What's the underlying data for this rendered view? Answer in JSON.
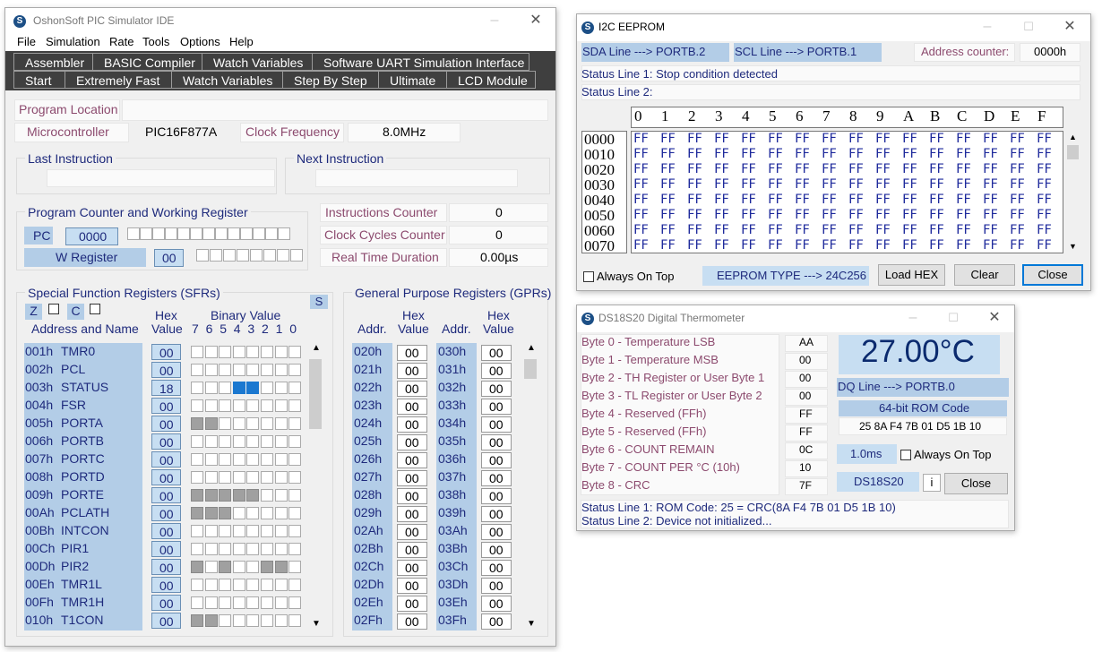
{
  "main": {
    "title": "OshonSoft PIC Simulator IDE",
    "menu": [
      "File",
      "Simulation",
      "Rate",
      "Tools",
      "Options",
      "Help"
    ],
    "toolbar1": [
      "Assembler",
      "BASIC Compiler",
      "Watch Variables",
      "Software UART Simulation Interface"
    ],
    "toolbar2": [
      "Start",
      "Extremely Fast",
      "Watch Variables",
      "Step By Step",
      "Ultimate",
      "LCD Module"
    ],
    "program_location_label": "Program Location",
    "microcontroller_label": "Microcontroller",
    "microcontroller_value": "PIC16F877A",
    "clock_frequency_label": "Clock Frequency",
    "clock_frequency_value": "8.0MHz",
    "last_instruction_label": "Last Instruction",
    "next_instruction_label": "Next Instruction",
    "pcwr_label": "Program Counter and Working Register",
    "pc_label": "PC",
    "pc_value": "0000",
    "w_label": "W Register",
    "w_value": "00",
    "instructions_counter_label": "Instructions Counter",
    "instructions_counter_value": "0",
    "clock_cycles_label": "Clock Cycles Counter",
    "clock_cycles_value": "0",
    "real_time_label": "Real Time Duration",
    "real_time_value": "0.00µs",
    "sfr_label": "Special Function Registers (SFRs)",
    "s_button": "S",
    "z_label": "Z",
    "c_label": "C",
    "addr_name_header": "Address and Name",
    "hex_header1": "Hex",
    "hex_header2": "Value",
    "binary_header": "Binary Value",
    "bit_numbers": [
      "7",
      "6",
      "5",
      "4",
      "3",
      "2",
      "1",
      "0"
    ],
    "sfrs": [
      {
        "addr": "001h",
        "name": "TMR0",
        "value": "00",
        "bits": "--------"
      },
      {
        "addr": "002h",
        "name": "PCL",
        "value": "00",
        "bits": "--------"
      },
      {
        "addr": "003h",
        "name": "STATUS",
        "value": "18",
        "bits": "---11---"
      },
      {
        "addr": "004h",
        "name": "FSR",
        "value": "00",
        "bits": "--------"
      },
      {
        "addr": "005h",
        "name": "PORTA",
        "value": "00",
        "bits": "gg------"
      },
      {
        "addr": "006h",
        "name": "PORTB",
        "value": "00",
        "bits": "--------"
      },
      {
        "addr": "007h",
        "name": "PORTC",
        "value": "00",
        "bits": "--------"
      },
      {
        "addr": "008h",
        "name": "PORTD",
        "value": "00",
        "bits": "--------"
      },
      {
        "addr": "009h",
        "name": "PORTE",
        "value": "00",
        "bits": "ggggg---"
      },
      {
        "addr": "00Ah",
        "name": "PCLATH",
        "value": "00",
        "bits": "ggg-----"
      },
      {
        "addr": "00Bh",
        "name": "INTCON",
        "value": "00",
        "bits": "--------"
      },
      {
        "addr": "00Ch",
        "name": "PIR1",
        "value": "00",
        "bits": "--------"
      },
      {
        "addr": "00Dh",
        "name": "PIR2",
        "value": "00",
        "bits": "g-g--gg-"
      },
      {
        "addr": "00Eh",
        "name": "TMR1L",
        "value": "00",
        "bits": "--------"
      },
      {
        "addr": "00Fh",
        "name": "TMR1H",
        "value": "00",
        "bits": "--------"
      },
      {
        "addr": "010h",
        "name": "T1CON",
        "value": "00",
        "bits": "gg------"
      }
    ],
    "gpr_label": "General Purpose Registers (GPRs)",
    "addr_header": "Addr.",
    "gpr_left": [
      {
        "addr": "020h",
        "value": "00"
      },
      {
        "addr": "021h",
        "value": "00"
      },
      {
        "addr": "022h",
        "value": "00"
      },
      {
        "addr": "023h",
        "value": "00"
      },
      {
        "addr": "024h",
        "value": "00"
      },
      {
        "addr": "025h",
        "value": "00"
      },
      {
        "addr": "026h",
        "value": "00"
      },
      {
        "addr": "027h",
        "value": "00"
      },
      {
        "addr": "028h",
        "value": "00"
      },
      {
        "addr": "029h",
        "value": "00"
      },
      {
        "addr": "02Ah",
        "value": "00"
      },
      {
        "addr": "02Bh",
        "value": "00"
      },
      {
        "addr": "02Ch",
        "value": "00"
      },
      {
        "addr": "02Dh",
        "value": "00"
      },
      {
        "addr": "02Eh",
        "value": "00"
      },
      {
        "addr": "02Fh",
        "value": "00"
      }
    ],
    "gpr_right": [
      {
        "addr": "030h",
        "value": "00"
      },
      {
        "addr": "031h",
        "value": "00"
      },
      {
        "addr": "032h",
        "value": "00"
      },
      {
        "addr": "033h",
        "value": "00"
      },
      {
        "addr": "034h",
        "value": "00"
      },
      {
        "addr": "035h",
        "value": "00"
      },
      {
        "addr": "036h",
        "value": "00"
      },
      {
        "addr": "037h",
        "value": "00"
      },
      {
        "addr": "038h",
        "value": "00"
      },
      {
        "addr": "039h",
        "value": "00"
      },
      {
        "addr": "03Ah",
        "value": "00"
      },
      {
        "addr": "03Bh",
        "value": "00"
      },
      {
        "addr": "03Ch",
        "value": "00"
      },
      {
        "addr": "03Dh",
        "value": "00"
      },
      {
        "addr": "03Eh",
        "value": "00"
      },
      {
        "addr": "03Fh",
        "value": "00"
      }
    ]
  },
  "eeprom": {
    "title": "I2C EEPROM",
    "sda": "SDA Line ---> PORTB.2",
    "scl": "SCL Line ---> PORTB.1",
    "address_counter_label": "Address counter:",
    "address_counter_value": "0000h",
    "status1": "Status Line 1: Stop condition detected",
    "status2": "Status Line 2:",
    "col_headers": [
      "0",
      "1",
      "2",
      "3",
      "4",
      "5",
      "6",
      "7",
      "8",
      "9",
      "A",
      "B",
      "C",
      "D",
      "E",
      "F"
    ],
    "row_addrs": [
      "0000",
      "0010",
      "0020",
      "0030",
      "0040",
      "0050",
      "0060",
      "0070"
    ],
    "cell_value": "FF",
    "always_on_top": "Always On Top",
    "type": "EEPROM TYPE ---> 24C256",
    "load_hex": "Load HEX",
    "clear": "Clear",
    "close": "Close"
  },
  "thermo": {
    "title": "DS18S20 Digital Thermometer",
    "bytes": [
      {
        "label": "Byte 0 - Temperature LSB",
        "value": "AA"
      },
      {
        "label": "Byte 1 - Temperature MSB",
        "value": "00"
      },
      {
        "label": "Byte 2 - TH Register or User Byte 1",
        "value": "00"
      },
      {
        "label": "Byte 3 - TL Register or User Byte 2",
        "value": "00"
      },
      {
        "label": "Byte 4 - Reserved (FFh)",
        "value": "FF"
      },
      {
        "label": "Byte 5 - Reserved (FFh)",
        "value": "FF"
      },
      {
        "label": "Byte 6 - COUNT REMAIN",
        "value": "0C"
      },
      {
        "label": "Byte 7 - COUNT PER °C (10h)",
        "value": "10"
      },
      {
        "label": "Byte 8 - CRC",
        "value": "7F"
      }
    ],
    "temperature": "27.00°C",
    "dq_line": "DQ Line ---> PORTB.0",
    "rom_label": "64-bit ROM Code",
    "rom_value": "25 8A F4 7B 01 D5 1B 10",
    "time": "1.0ms",
    "always_on_top": "Always On Top",
    "model": "DS18S20",
    "info_button": "i",
    "close": "Close",
    "status1": "Status Line 1: ROM Code: 25 = CRC(8A F4 7B 01 D5 1B 10)",
    "status2": "Status Line 2: Device not initialized..."
  }
}
